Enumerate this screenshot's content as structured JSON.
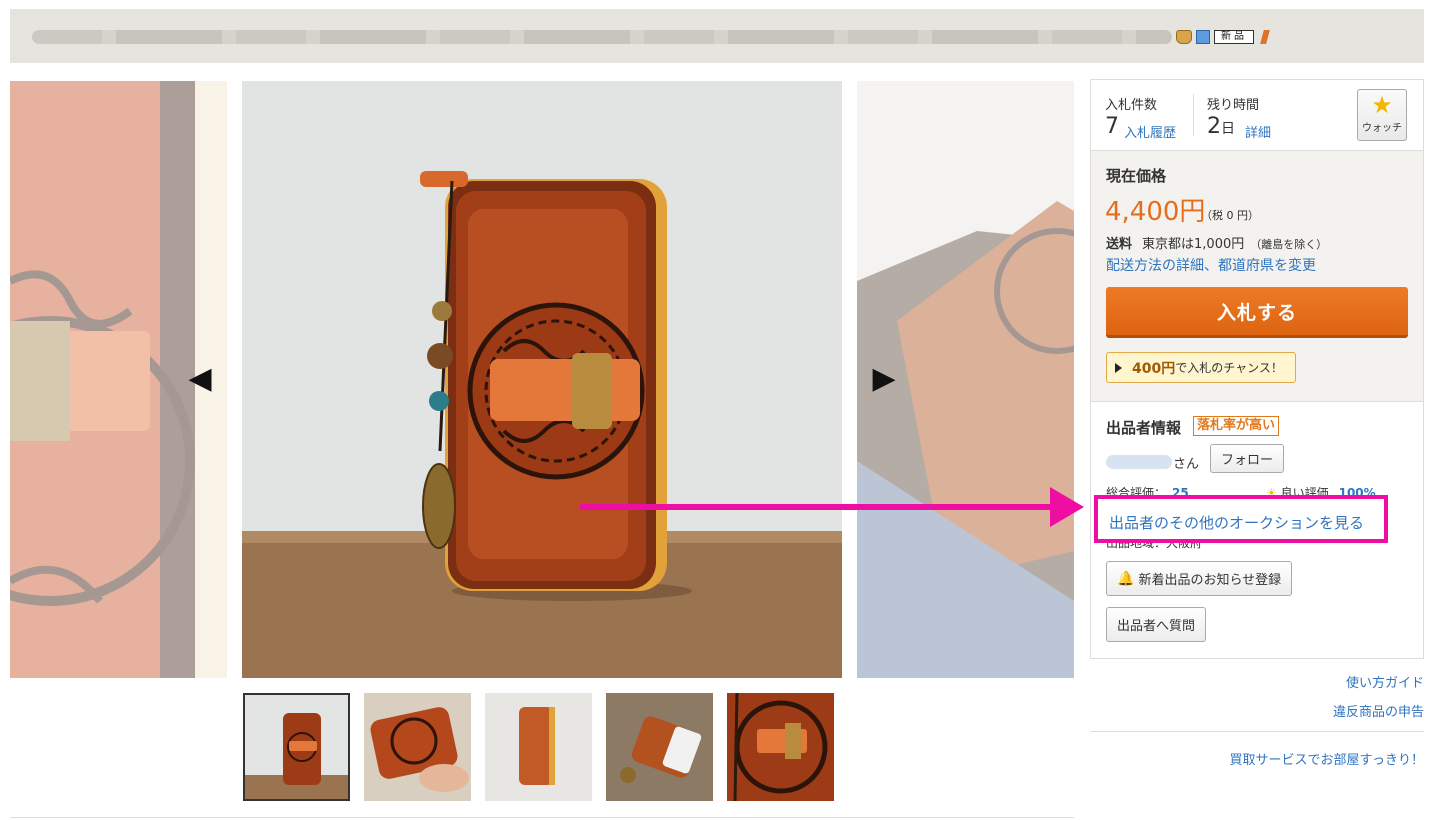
{
  "title_bar": {
    "new_badge": "新品",
    "icons": [
      "trophy-icon",
      "sparkle-icon",
      "new-badge",
      "flame-icon"
    ]
  },
  "gallery": {
    "prev_arrow": "◀",
    "next_arrow": "▶",
    "thumbnail_count": 5,
    "selected_thumbnail": 1
  },
  "bid": {
    "count_label": "入札件数",
    "count_value": "7",
    "history_link": "入札履歴",
    "time_label": "残り時間",
    "time_value": "2",
    "time_unit": "日",
    "detail_link": "詳細",
    "watch_label": "ウォッチ"
  },
  "price": {
    "label": "現在価格",
    "value": "4,400円",
    "tax": "（税 0 円）",
    "shipping_label": "送料",
    "shipping_text": "東京都は1,000円",
    "shipping_note": "（離島を除く）",
    "shipping_link": "配送方法の詳細、都道府県を変更",
    "bid_button": "入札する",
    "chance_amount": "400円",
    "chance_text": "で入札のチャンス！"
  },
  "seller": {
    "title": "出品者情報",
    "badge": "落札率が高い",
    "name_suffix": "さん",
    "follow_button": "フォロー",
    "total_rating_label": "総合評価：",
    "total_rating_value": "25",
    "good_rating_label": "良い評価",
    "good_rating_value": "100%",
    "other_auctions_link": "出品者のその他のオークションを見る",
    "region": "出品地域：大阪府",
    "notify_button": "新着出品のお知らせ登録",
    "question_button": "出品者へ質問"
  },
  "links": {
    "guide": "使い方ガイド",
    "report": "違反商品の申告",
    "buyback": "買取サービスでお部屋すっきり！"
  },
  "colors": {
    "accent_orange": "#e66e1b",
    "link_blue": "#2f74c0",
    "highlight_magenta": "#ee0ea4"
  }
}
